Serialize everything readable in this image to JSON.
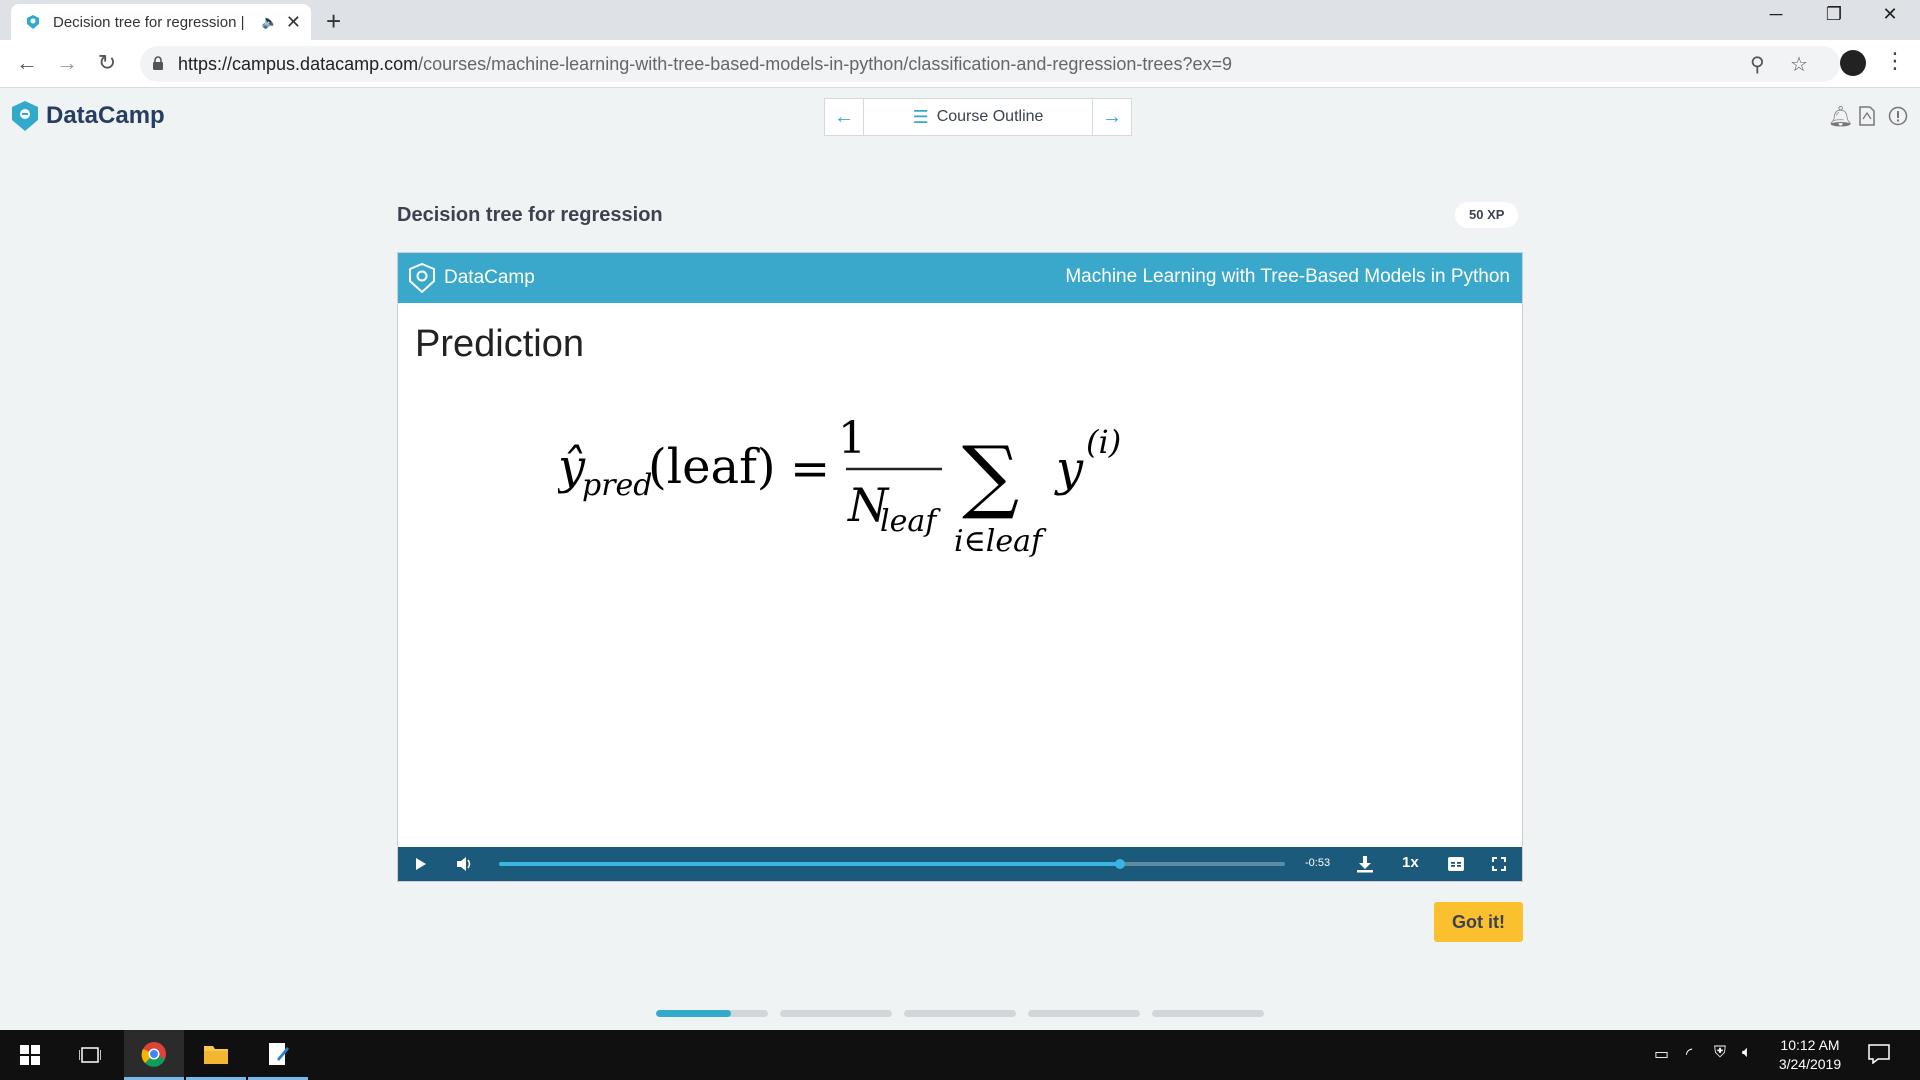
{
  "browser": {
    "tab_title": "Decision tree for regression |",
    "new_tab": "+",
    "url_host": "https://campus.datacamp.com",
    "url_path": "/courses/machine-learning-with-tree-based-models-in-python/classification-and-regression-trees?ex=9"
  },
  "header": {
    "logo": "DataCamp",
    "course_outline": "Course Outline"
  },
  "exercise": {
    "title": "Decision tree for regression",
    "xp": "50 XP"
  },
  "slide": {
    "logo": "DataCamp",
    "course": "Machine Learning with Tree-Based Models in Python",
    "heading": "Prediction",
    "formula": {
      "lhs": "ŷ",
      "lhs_sub": "pred",
      "lhs_arg": "(leaf)",
      "equals": "=",
      "numerator": "1",
      "denominator": "N",
      "denominator_sub": "leaf",
      "sum": "∑",
      "sum_sub": "i∈leaf",
      "term": "y",
      "term_sup": "(i)"
    }
  },
  "player": {
    "time": "-0:53",
    "speed": "1x",
    "progress": 0.79
  },
  "actions": {
    "got_it": "Got it!"
  },
  "pagination": {
    "count": 5,
    "current_fill": 0.67
  },
  "taskbar": {
    "time": "10:12 AM",
    "date": "3/24/2019"
  },
  "colors": {
    "brand_blue": "#3aa8cb",
    "player_bar": "#1b5a7a",
    "got_it": "#fbc02d"
  }
}
